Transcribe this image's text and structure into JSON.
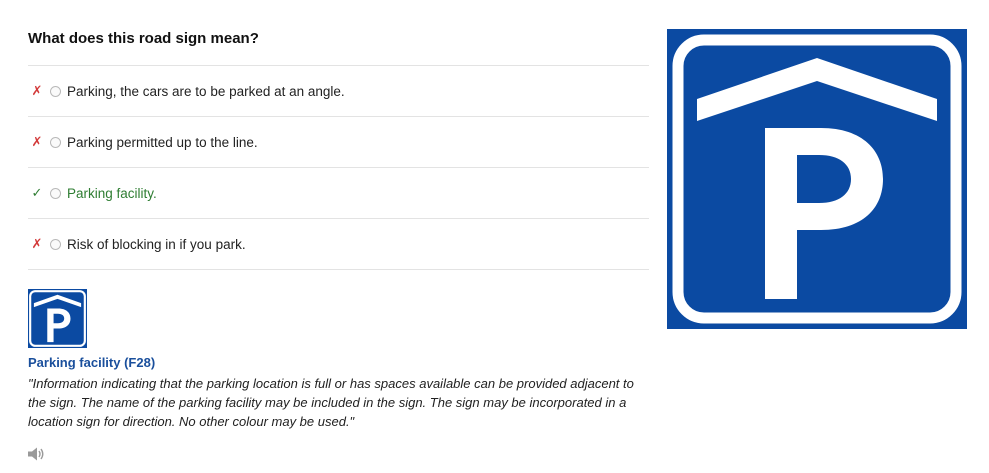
{
  "question": {
    "title": "What does this road sign mean?"
  },
  "options": [
    {
      "label": "Parking, the cars are to be parked at an angle.",
      "status": "wrong",
      "mark": "✗"
    },
    {
      "label": "Parking permitted up to the line.",
      "status": "wrong",
      "mark": "✗"
    },
    {
      "label": "Parking facility.",
      "status": "correct",
      "mark": "✓"
    },
    {
      "label": "Risk of blocking in if you park.",
      "status": "wrong",
      "mark": "✗"
    }
  ],
  "sign": {
    "name": "Parking facility (F28)",
    "description": "\"Information indicating that the parking location is full or has spaces available can be provided adjacent to the sign. The name of the parking facility may be included in the sign. The sign may be incorporated in a location sign for direction. No other colour may be used.\"",
    "colors": {
      "blue": "#0b4aa2",
      "white": "#ffffff"
    }
  },
  "audio": {
    "icon": "speaker-icon"
  }
}
